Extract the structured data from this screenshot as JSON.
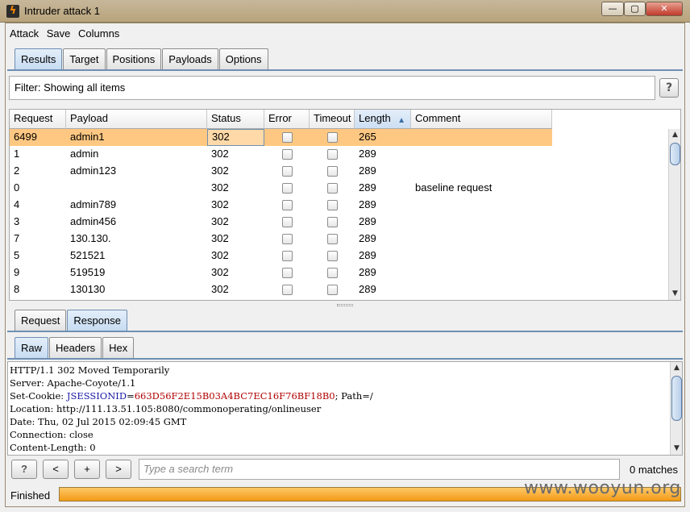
{
  "window": {
    "title": "Intruder attack 1",
    "min": "—",
    "max": "▢",
    "close": "✕"
  },
  "menu": [
    "Attack",
    "Save",
    "Columns"
  ],
  "main_tabs": [
    {
      "label": "Results",
      "active": true
    },
    {
      "label": "Target",
      "active": false
    },
    {
      "label": "Positions",
      "active": false
    },
    {
      "label": "Payloads",
      "active": false
    },
    {
      "label": "Options",
      "active": false
    }
  ],
  "filter": {
    "text": "Filter: Showing all items",
    "help": "?"
  },
  "table": {
    "columns": [
      "Request",
      "Payload",
      "Status",
      "Error",
      "Timeout",
      "Length",
      "Comment"
    ],
    "sorted_column": "Length",
    "rows": [
      {
        "request": "6499",
        "payload": "admin1",
        "status": "302",
        "error": false,
        "timeout": false,
        "length": "265",
        "comment": "",
        "selected": true
      },
      {
        "request": "1",
        "payload": "admin",
        "status": "302",
        "error": false,
        "timeout": false,
        "length": "289",
        "comment": ""
      },
      {
        "request": "2",
        "payload": "admin123",
        "status": "302",
        "error": false,
        "timeout": false,
        "length": "289",
        "comment": ""
      },
      {
        "request": "0",
        "payload": "",
        "status": "302",
        "error": false,
        "timeout": false,
        "length": "289",
        "comment": "baseline request"
      },
      {
        "request": "4",
        "payload": "admin789",
        "status": "302",
        "error": false,
        "timeout": false,
        "length": "289",
        "comment": ""
      },
      {
        "request": "3",
        "payload": "admin456",
        "status": "302",
        "error": false,
        "timeout": false,
        "length": "289",
        "comment": ""
      },
      {
        "request": "7",
        "payload": "130.130.",
        "status": "302",
        "error": false,
        "timeout": false,
        "length": "289",
        "comment": ""
      },
      {
        "request": "5",
        "payload": "521521",
        "status": "302",
        "error": false,
        "timeout": false,
        "length": "289",
        "comment": ""
      },
      {
        "request": "9",
        "payload": "519519",
        "status": "302",
        "error": false,
        "timeout": false,
        "length": "289",
        "comment": ""
      },
      {
        "request": "8",
        "payload": "130130",
        "status": "302",
        "error": false,
        "timeout": false,
        "length": "289",
        "comment": ""
      }
    ]
  },
  "reqresp_tabs": [
    {
      "label": "Request",
      "active": false
    },
    {
      "label": "Response",
      "active": true
    }
  ],
  "view_tabs": [
    {
      "label": "Raw",
      "active": true
    },
    {
      "label": "Headers",
      "active": false
    },
    {
      "label": "Hex",
      "active": false
    }
  ],
  "response": {
    "lines": [
      "HTTP/1.1 302 Moved Temporarily",
      "Server: Apache-Coyote/1.1",
      "Location: http://111.13.51.105:8080/commonoperating/onlineuser",
      "Date: Thu, 02 Jul 2015 02:09:45 GMT",
      "Connection: close",
      "Content-Length: 0"
    ],
    "cookie": {
      "prefix": "Set-Cookie: ",
      "name": "JSESSIONID",
      "eq": "=",
      "value": "663D56F2E15B03A4BC7EC16F76BF18B0",
      "suffix": "; Path=/"
    }
  },
  "search": {
    "help": "?",
    "prev": "<",
    "add": "+",
    "next": ">",
    "placeholder": "Type a search term",
    "matches": "0 matches"
  },
  "status": {
    "label": "Finished",
    "progress_fraction": 1.0
  },
  "watermark": "www.wooyun.org"
}
